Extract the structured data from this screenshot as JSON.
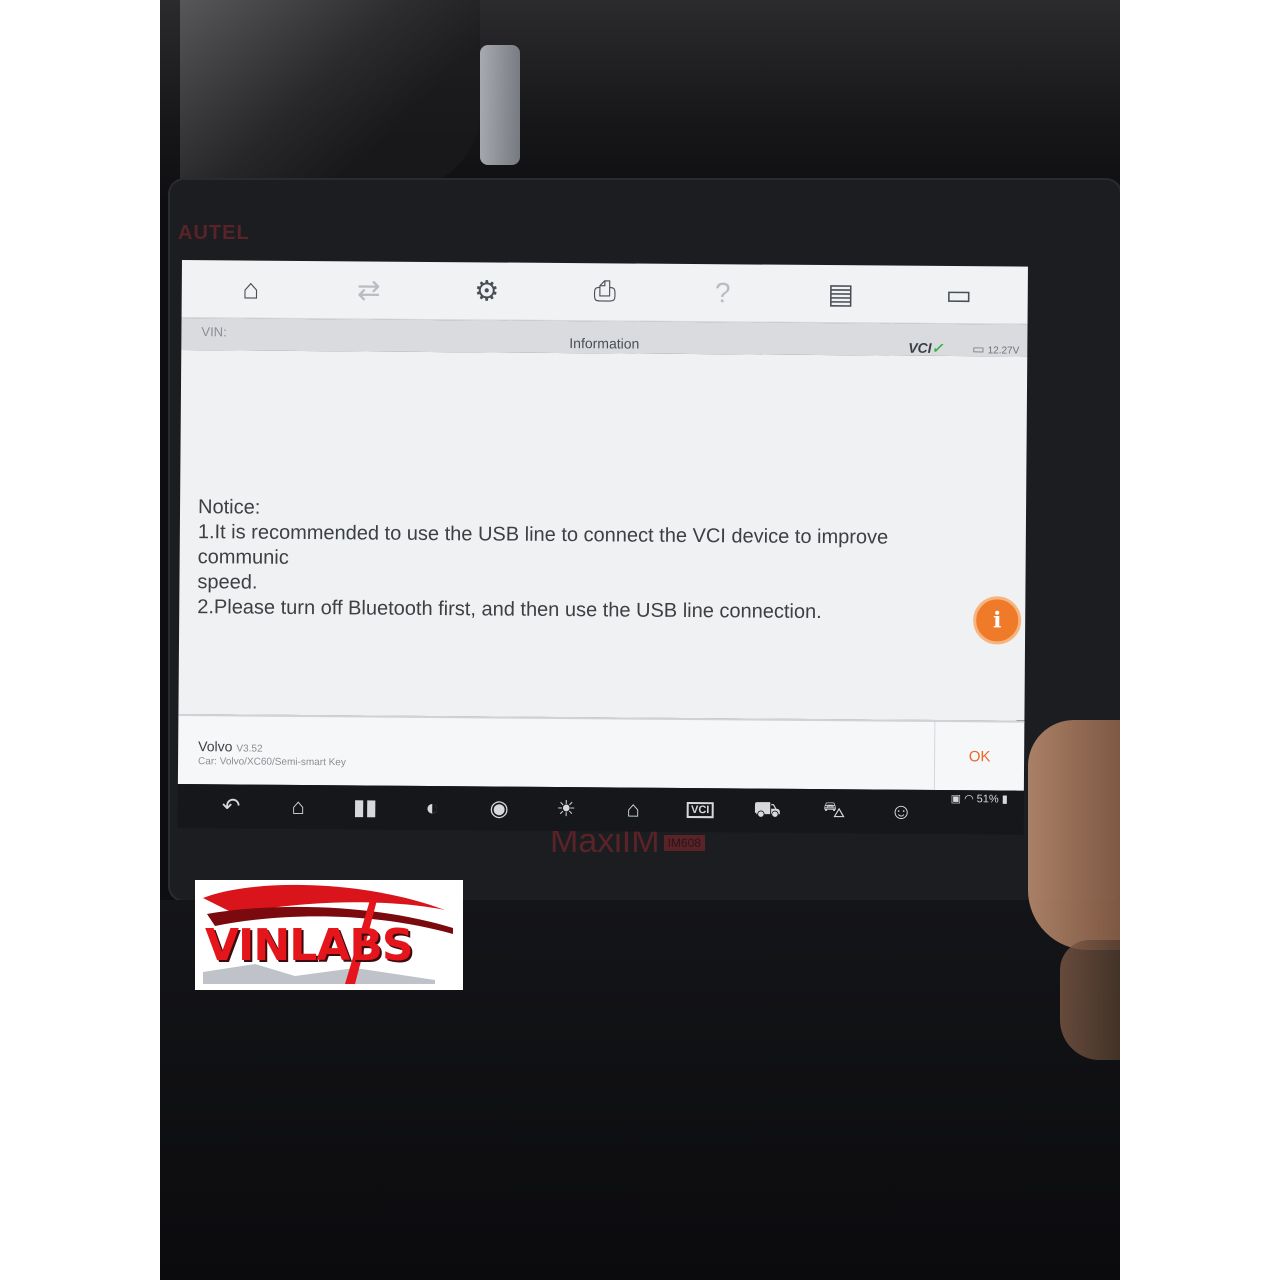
{
  "toolbar": {
    "items": [
      {
        "name": "home",
        "icon": "home-icon",
        "glyph": "⌂",
        "enabled": true
      },
      {
        "name": "vehicle-swap",
        "icon": "car-swap-icon",
        "glyph": "⇄",
        "enabled": false
      },
      {
        "name": "settings",
        "icon": "gear-icon",
        "glyph": "⚙",
        "enabled": true
      },
      {
        "name": "print",
        "icon": "printer-icon",
        "glyph": "⎙",
        "enabled": true
      },
      {
        "name": "help",
        "icon": "help-icon",
        "glyph": "?",
        "enabled": false
      },
      {
        "name": "save",
        "icon": "save-icon",
        "glyph": "▤",
        "enabled": true
      },
      {
        "name": "feedback",
        "icon": "message-icon",
        "glyph": "▭",
        "enabled": true
      }
    ]
  },
  "titlebar": {
    "vin_label": "VIN:",
    "title": "Information",
    "vci_label": "VCI",
    "vci_status_glyph": "✓",
    "battery_voltage": "12.27V"
  },
  "notice": {
    "heading": "Notice:",
    "line1": "1.It is recommended to use the USB line to connect the VCI device to improve communic",
    "line1_cont": "speed.",
    "line2": "2.Please turn off Bluetooth first, and then use the USB line connection."
  },
  "info_button": {
    "glyph": "i",
    "icon": "manual-info-icon",
    "color": "#ef7a2a"
  },
  "footer": {
    "car_name": "Volvo",
    "version": "V3.52",
    "path": "Car: Volvo/XC60/Semi-smart Key",
    "ok_label": "OK"
  },
  "sysbar": {
    "buttons": [
      {
        "name": "back",
        "icon": "back-icon",
        "glyph": "↶"
      },
      {
        "name": "android-home",
        "icon": "home-icon",
        "glyph": "⌂"
      },
      {
        "name": "recent-apps",
        "icon": "recent-apps-icon",
        "glyph": "▮▮"
      },
      {
        "name": "browser",
        "icon": "chrome-icon",
        "glyph": "◐"
      },
      {
        "name": "camera",
        "icon": "camera-icon",
        "glyph": "◉"
      },
      {
        "name": "brightness",
        "icon": "brightness-icon",
        "glyph": "☀"
      },
      {
        "name": "maxi-home",
        "icon": "maxi-home-icon",
        "glyph": "⌂"
      },
      {
        "name": "vci-status",
        "icon": "vci-icon",
        "glyph": "VCI"
      },
      {
        "name": "vehicle-connect",
        "icon": "vehicle-connect-icon",
        "glyph": "⛟"
      },
      {
        "name": "vehicle",
        "icon": "car-icon",
        "glyph": "⛍"
      },
      {
        "name": "user",
        "icon": "user-car-icon",
        "glyph": "☺"
      }
    ],
    "battery_percent": "51%"
  },
  "device": {
    "brand_top": "AUTEL",
    "model": "MaxiIM",
    "model_badge": "IM608"
  },
  "watermark": {
    "text": "VINLABS"
  },
  "colors": {
    "accent": "#ef7a2a",
    "ok_text": "#e86a2a",
    "vci_ok": "#3bb54a",
    "logo_red": "#e5151c"
  }
}
